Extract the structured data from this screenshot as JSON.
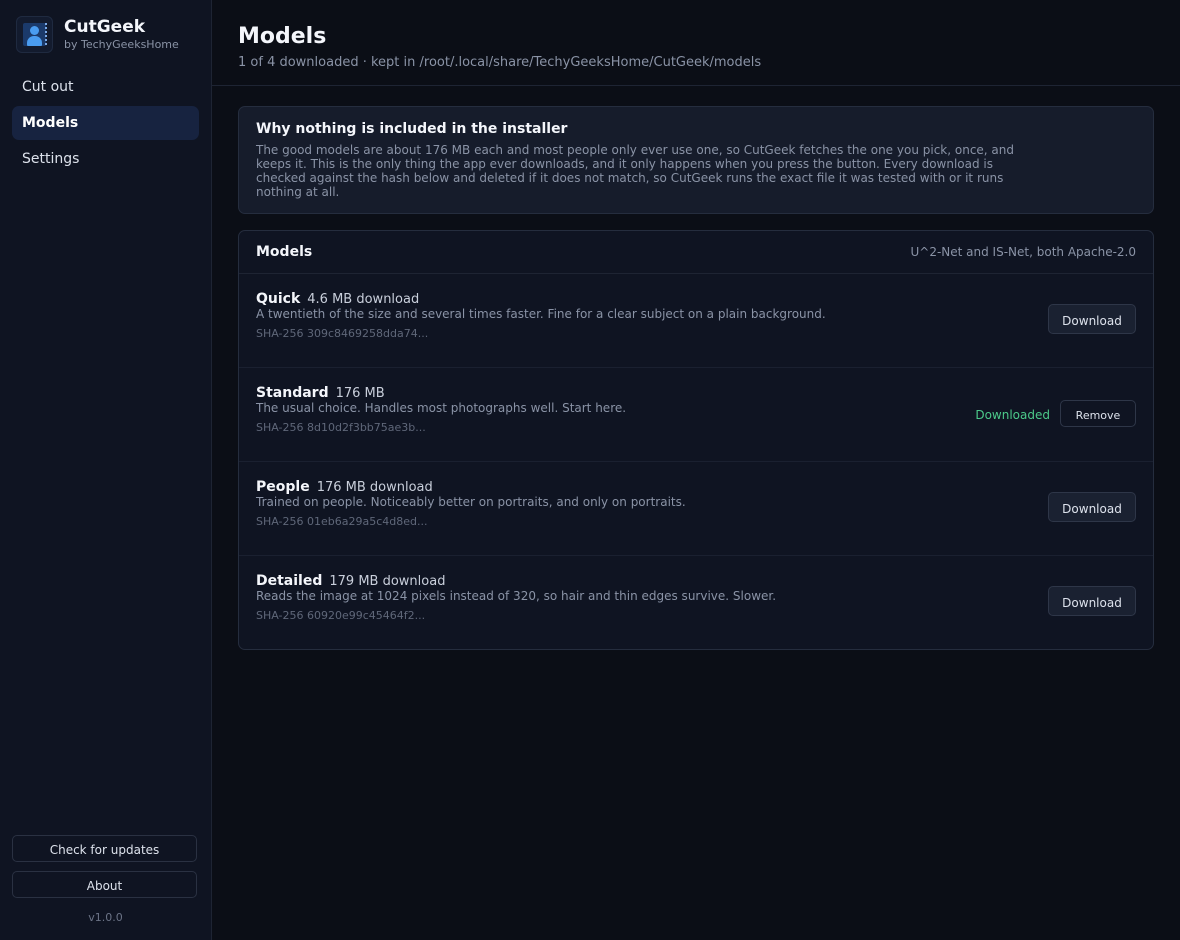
{
  "app": {
    "name": "CutGeek",
    "byline": "by TechyGeeksHome",
    "version": "v1.0.0"
  },
  "nav": {
    "items": [
      {
        "label": "Cut out",
        "active": false
      },
      {
        "label": "Models",
        "active": true
      },
      {
        "label": "Settings",
        "active": false
      }
    ]
  },
  "sidebar_buttons": {
    "check_updates": "Check for updates",
    "about": "About"
  },
  "header": {
    "title": "Models",
    "subtitle": "1 of 4 downloaded · kept in /root/.local/share/TechyGeeksHome/CutGeek/models"
  },
  "info": {
    "title": "Why nothing is included in the installer",
    "text": "The good models are about 176 MB each and most people only ever use one, so CutGeek fetches the one you pick, once, and keeps it. This is the only thing the app ever downloads, and it only happens when you press the button. Every download is checked against the hash below and deleted if it does not match, so CutGeek runs the exact file it was tested with or it runs nothing at all."
  },
  "models": {
    "title": "Models",
    "note": "U^2-Net and IS-Net, both Apache-2.0",
    "rows": [
      {
        "name": "Quick",
        "size": "4.6 MB download",
        "desc": "A twentieth of the size and several times faster. Fine for a clear subject on a plain background.",
        "hash": "SHA-256 309c8469258dda74...",
        "button": "Download"
      },
      {
        "name": "Standard",
        "size": "176 MB",
        "desc": "The usual choice. Handles most photographs well. Start here.",
        "hash": "SHA-256 8d10d2f3bb75ae3b...",
        "status": "Downloaded",
        "button": "Remove"
      },
      {
        "name": "People",
        "size": "176 MB download",
        "desc": "Trained on people. Noticeably better on portraits, and only on portraits.",
        "hash": "SHA-256 01eb6a29a5c4d8ed...",
        "button": "Download"
      },
      {
        "name": "Detailed",
        "size": "179 MB download",
        "desc": "Reads the image at 1024 pixels instead of 320, so hair and thin edges survive. Slower.",
        "hash": "SHA-256 60920e99c45464f2...",
        "button": "Download"
      }
    ]
  },
  "colors": {
    "background": "#0b0e16",
    "sidebar": "#0f1422",
    "accent": "#4a9cf0",
    "active_nav": "#172340",
    "success": "#4cc98a"
  },
  "icons": {
    "logo": "cutout-person-logo-icon"
  }
}
